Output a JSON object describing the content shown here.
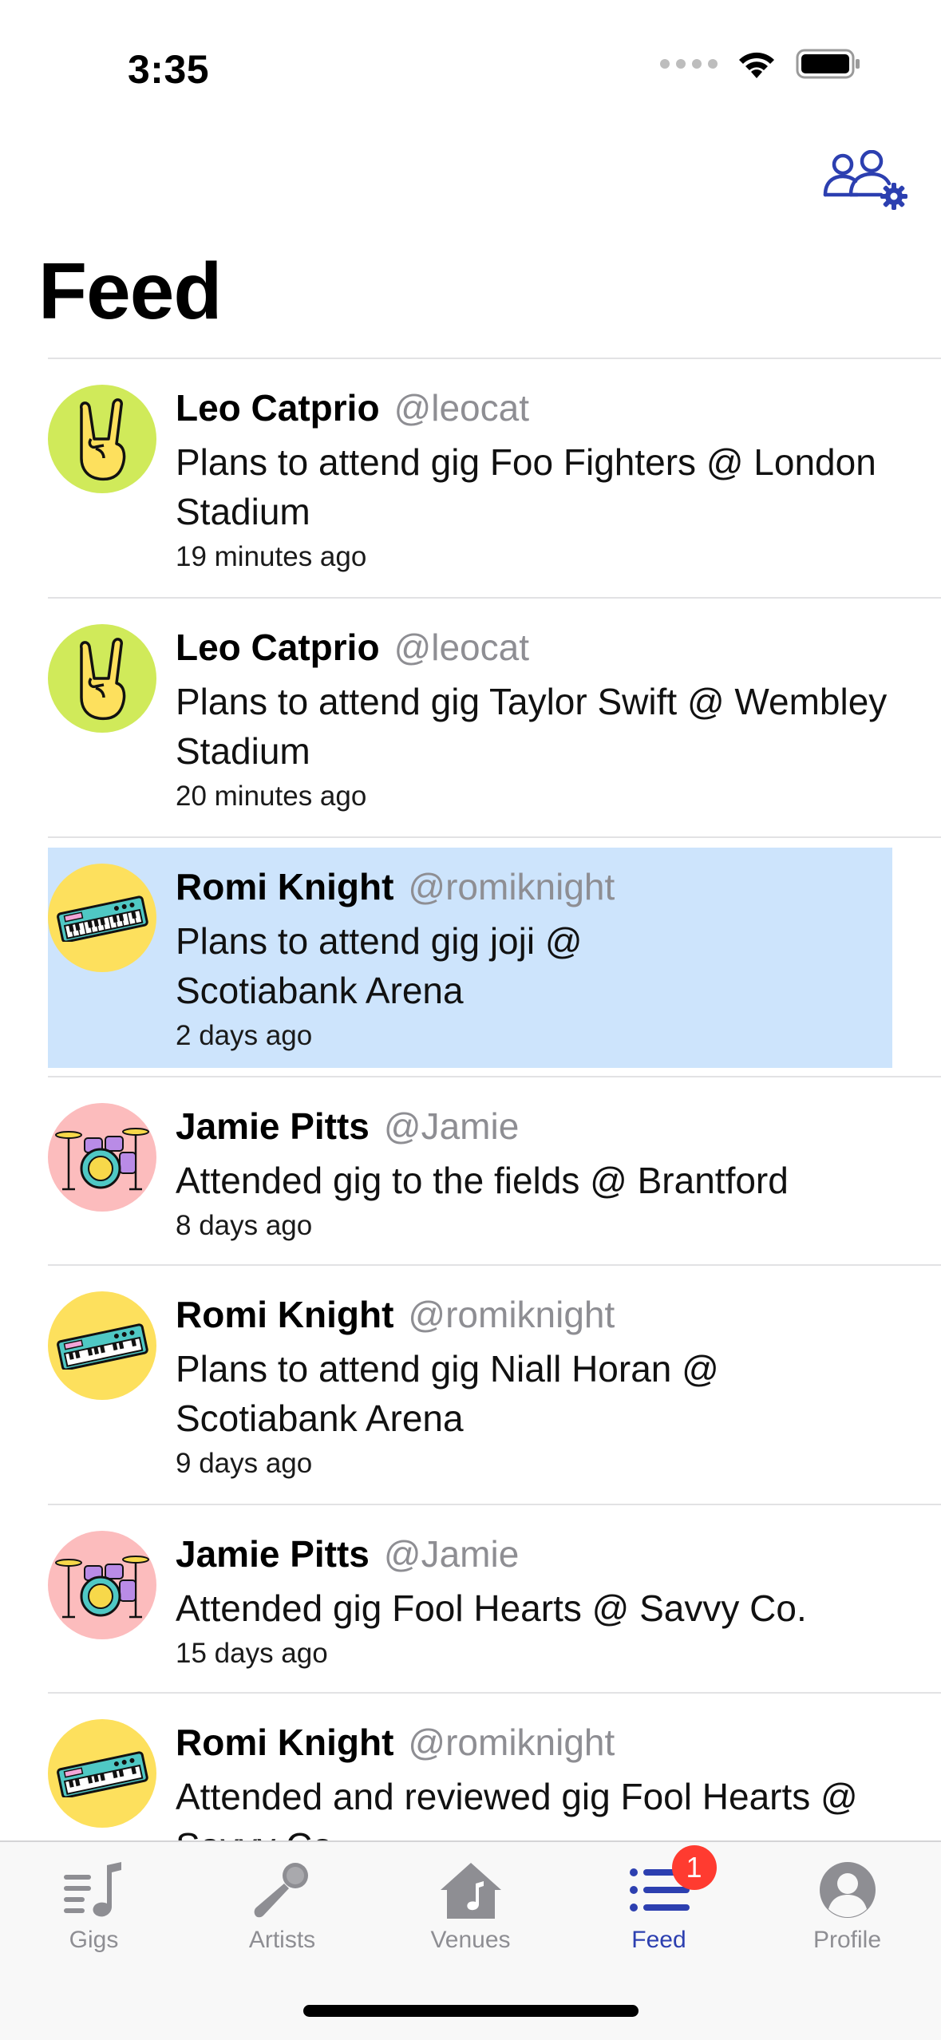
{
  "status_bar": {
    "time": "3:35"
  },
  "header": {
    "title": "Feed",
    "people_icon": "people-settings-icon",
    "accent_color": "#2c3fb0"
  },
  "feed": [
    {
      "name": "Leo Catprio",
      "handle": "@leocat",
      "activity": "Plans to attend gig Foo Fighters @ London Stadium",
      "time": "19 minutes ago",
      "avatar": "rock-hand-icon",
      "avatar_color": "#d0ea5a"
    },
    {
      "name": "Leo Catprio",
      "handle": "@leocat",
      "activity": "Plans to attend gig Taylor Swift @ Wembley Stadium",
      "time": "20 minutes ago",
      "avatar": "rock-hand-icon",
      "avatar_color": "#d0ea5a"
    },
    {
      "name": "Romi Knight",
      "handle": "@romiknight",
      "activity": "Plans to attend gig joji @ Scotiabank Arena",
      "time": "2 days ago",
      "avatar": "keyboard-icon",
      "avatar_color": "#fde05d",
      "highlighted": true
    },
    {
      "name": "Jamie Pitts",
      "handle": "@Jamie",
      "activity": "Attended gig to the fields @ Brantford",
      "time": "8 days ago",
      "avatar": "drum-kit-icon",
      "avatar_color": "#fcbcbd"
    },
    {
      "name": "Romi Knight",
      "handle": "@romiknight",
      "activity": "Plans to attend gig Niall Horan @ Scotiabank Arena",
      "time": "9 days ago",
      "avatar": "keyboard-icon",
      "avatar_color": "#fde05d"
    },
    {
      "name": "Jamie Pitts",
      "handle": "@Jamie",
      "activity": "Attended gig Fool Hearts @ Savvy Co.",
      "time": "15 days ago",
      "avatar": "drum-kit-icon",
      "avatar_color": "#fcbcbd"
    },
    {
      "name": "Romi Knight",
      "handle": "@romiknight",
      "activity": "Attended and reviewed gig Fool Hearts @ Savvy Co.",
      "time": "",
      "avatar": "keyboard-icon",
      "avatar_color": "#fde05d"
    }
  ],
  "tabs": [
    {
      "label": "Gigs",
      "icon": "music-list-icon"
    },
    {
      "label": "Artists",
      "icon": "microphone-icon"
    },
    {
      "label": "Venues",
      "icon": "music-house-icon"
    },
    {
      "label": "Feed",
      "icon": "feed-list-icon",
      "active": true,
      "badge": "1"
    },
    {
      "label": "Profile",
      "icon": "profile-icon"
    }
  ]
}
